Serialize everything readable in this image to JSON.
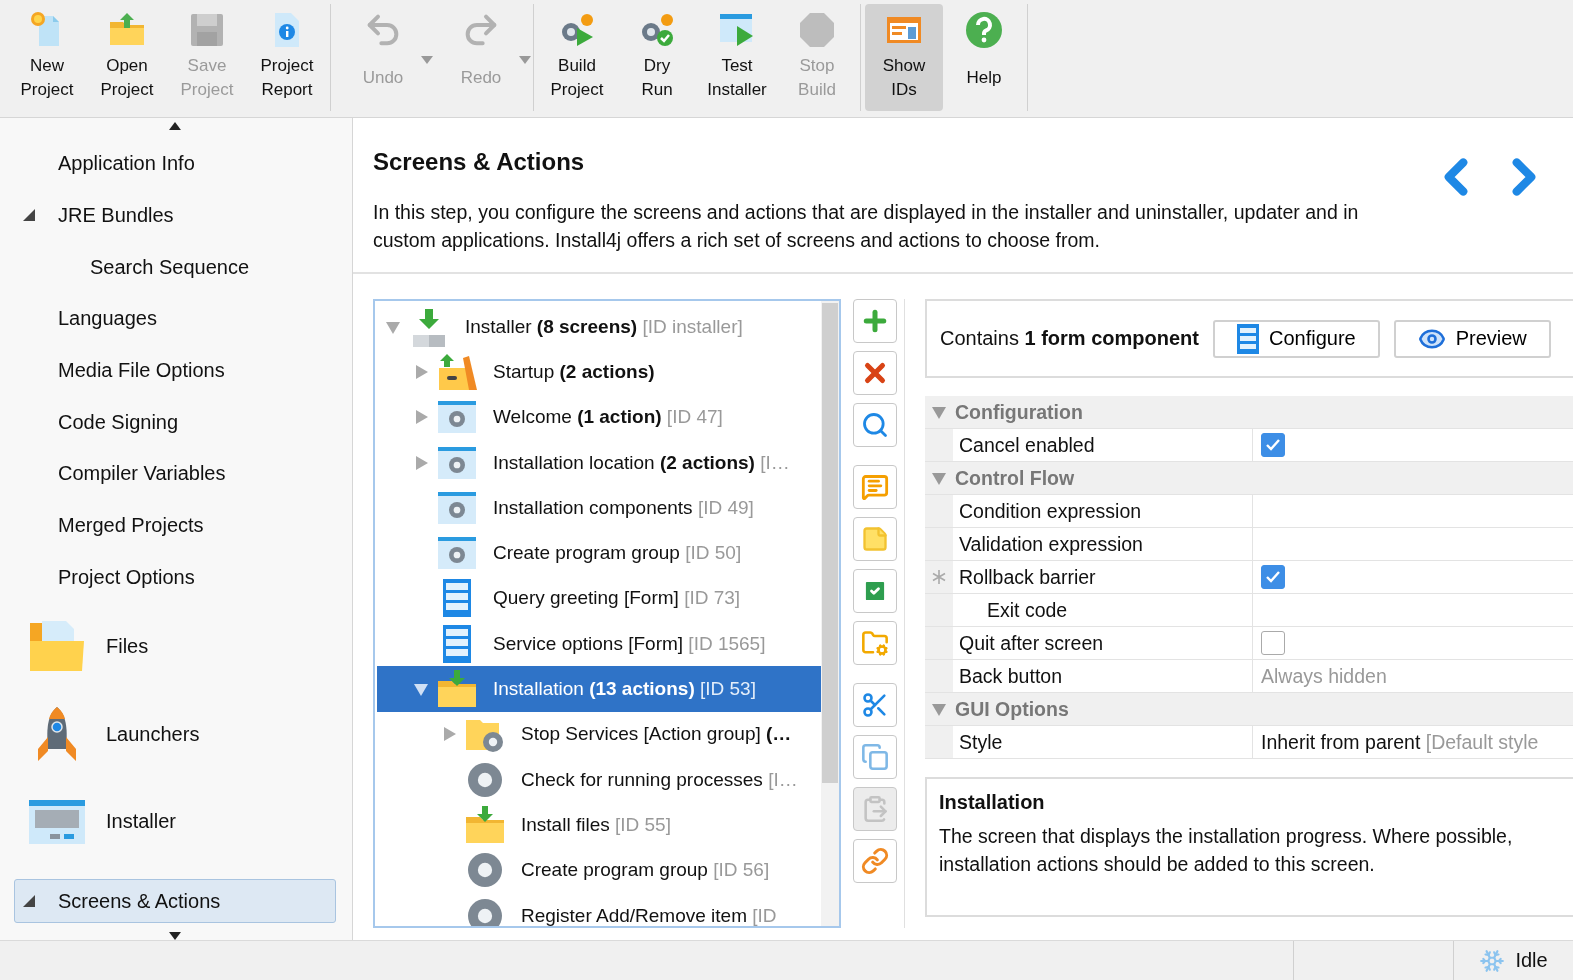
{
  "toolbar": {
    "groups": [
      [
        {
          "lines": [
            "New",
            "Project"
          ],
          "disabled": false,
          "selected": false,
          "dropdown": false
        },
        {
          "lines": [
            "Open",
            "Project"
          ],
          "disabled": false,
          "selected": false,
          "dropdown": false
        },
        {
          "lines": [
            "Save",
            "Project"
          ],
          "disabled": true,
          "selected": false,
          "dropdown": false
        },
        {
          "lines": [
            "Project",
            "Report"
          ],
          "disabled": false,
          "selected": false,
          "dropdown": false
        }
      ],
      [
        {
          "lines": [
            "Undo"
          ],
          "disabled": true,
          "selected": false,
          "dropdown": true
        },
        {
          "lines": [
            "Redo"
          ],
          "disabled": true,
          "selected": false,
          "dropdown": true
        }
      ],
      [
        {
          "lines": [
            "Build",
            "Project"
          ],
          "disabled": false,
          "selected": false,
          "dropdown": false
        },
        {
          "lines": [
            "Dry",
            "Run"
          ],
          "disabled": false,
          "selected": false,
          "dropdown": false
        },
        {
          "lines": [
            "Test",
            "Installer"
          ],
          "disabled": false,
          "selected": false,
          "dropdown": false
        },
        {
          "lines": [
            "Stop",
            "Build"
          ],
          "disabled": true,
          "selected": false,
          "dropdown": false
        }
      ],
      [
        {
          "lines": [
            "Show",
            "IDs"
          ],
          "disabled": false,
          "selected": true,
          "dropdown": false
        },
        {
          "lines": [
            "Help"
          ],
          "disabled": false,
          "selected": false,
          "dropdown": false
        }
      ]
    ]
  },
  "sidebar": {
    "items": [
      {
        "kind": "page",
        "label": "Application Info",
        "selected": false
      },
      {
        "kind": "page",
        "label": "JRE Bundles",
        "selected": false,
        "expanded": true,
        "children": [
          {
            "kind": "page",
            "label": "Search Sequence",
            "selected": false
          }
        ]
      },
      {
        "kind": "page",
        "label": "Languages",
        "selected": false
      },
      {
        "kind": "page",
        "label": "Media File Options",
        "selected": false
      },
      {
        "kind": "page",
        "label": "Code Signing",
        "selected": false
      },
      {
        "kind": "page",
        "label": "Compiler Variables",
        "selected": false
      },
      {
        "kind": "page",
        "label": "Merged Projects",
        "selected": false
      },
      {
        "kind": "page",
        "label": "Project Options",
        "selected": false
      },
      {
        "kind": "category",
        "label": "Files",
        "selected": false
      },
      {
        "kind": "category",
        "label": "Launchers",
        "selected": false
      },
      {
        "kind": "category",
        "label": "Installer",
        "selected": false
      },
      {
        "kind": "page",
        "label": "Screens & Actions",
        "selected": true,
        "expanded": true
      }
    ]
  },
  "header": {
    "title": "Screens & Actions",
    "description": "In this step, you configure the screens and actions that are displayed in the installer and uninstaller, updater and in custom applications. Install4j offers a rich set of screens and actions to choose from."
  },
  "tree": {
    "nodes": [
      {
        "kind": "root",
        "label": "Installer **(8 screens)**",
        "id": "[ID installer]",
        "selected": false,
        "expanded": true,
        "children": [
          {
            "kind": "startup",
            "label": "Startup **(2 actions)**",
            "selected": false,
            "expanded": false
          },
          {
            "kind": "screen",
            "label": "Welcome **(1 action)**",
            "id": "[ID 47]",
            "selected": false,
            "expanded": false
          },
          {
            "kind": "screen",
            "label": "Installation location **(2 actions)**",
            "id": "[I…",
            "selected": false,
            "expanded": false
          },
          {
            "kind": "screen",
            "label": "Installation components",
            "id": "[ID 49]",
            "selected": false
          },
          {
            "kind": "screen",
            "label": "Create program group",
            "id": "[ID 50]",
            "selected": false
          },
          {
            "kind": "form",
            "label": "Query greeting [Form]",
            "id": "[ID 73]",
            "selected": false
          },
          {
            "kind": "form",
            "label": "Service options [Form]",
            "id": "[ID 1565]",
            "selected": false
          },
          {
            "kind": "folder",
            "label": "Installation **(13 actions)**",
            "id": "[ID 53]",
            "selected": true,
            "expanded": true,
            "children": [
              {
                "kind": "group",
                "label": "Stop Services [Action group] **(…**",
                "selected": false,
                "expanded": false
              },
              {
                "kind": "action",
                "label": "Check for running processes",
                "id": "[I…",
                "selected": false
              },
              {
                "kind": "install",
                "label": "Install files",
                "id": "[ID 55]",
                "selected": false
              },
              {
                "kind": "action",
                "label": "Create program group",
                "id": "[ID 56]",
                "selected": false
              },
              {
                "kind": "action",
                "label": "Register Add/Remove item",
                "id": "[ID",
                "selected": false
              }
            ]
          }
        ]
      }
    ]
  },
  "side_tools": [
    [
      {
        "disabled": false
      },
      {
        "disabled": false
      },
      {
        "disabled": false
      }
    ],
    [
      {
        "disabled": false
      },
      {
        "disabled": false
      },
      {
        "disabled": false
      },
      {
        "disabled": false
      }
    ],
    [
      {
        "disabled": false
      },
      {
        "disabled": false
      },
      {
        "disabled": true
      },
      {
        "disabled": false
      }
    ]
  ],
  "form_box": {
    "text": "Contains **1 form component**",
    "buttons": [
      "Configure",
      "Preview"
    ]
  },
  "properties": {
    "sections": [
      {
        "title": "Configuration",
        "expanded": true,
        "rows": [
          {
            "label": "Cancel enabled",
            "kind": "checkbox",
            "checked": true
          }
        ]
      },
      {
        "title": "Control Flow",
        "expanded": true,
        "rows": [
          {
            "label": "Condition expression"
          },
          {
            "label": "Validation expression"
          },
          {
            "label": "Rollback barrier",
            "kind": "checkbox",
            "checked": true,
            "modified": true,
            "children": [
              {
                "label": "Exit code"
              }
            ]
          },
          {
            "label": "Quit after screen",
            "kind": "checkbox",
            "checked": false
          },
          {
            "label": "Back button",
            "kind": "muted",
            "value": "Always hidden"
          }
        ]
      },
      {
        "title": "GUI Options",
        "expanded": true,
        "rows": [
          {
            "label": "Style",
            "kind": "text",
            "value": "Inherit from parent",
            "hint": "[Default style"
          }
        ]
      }
    ]
  },
  "description": {
    "title": "Installation",
    "text": "The screen that displays the installation progress. Where possible, installation actions should be added to this screen."
  },
  "status_bar": {
    "text": "Idle"
  }
}
